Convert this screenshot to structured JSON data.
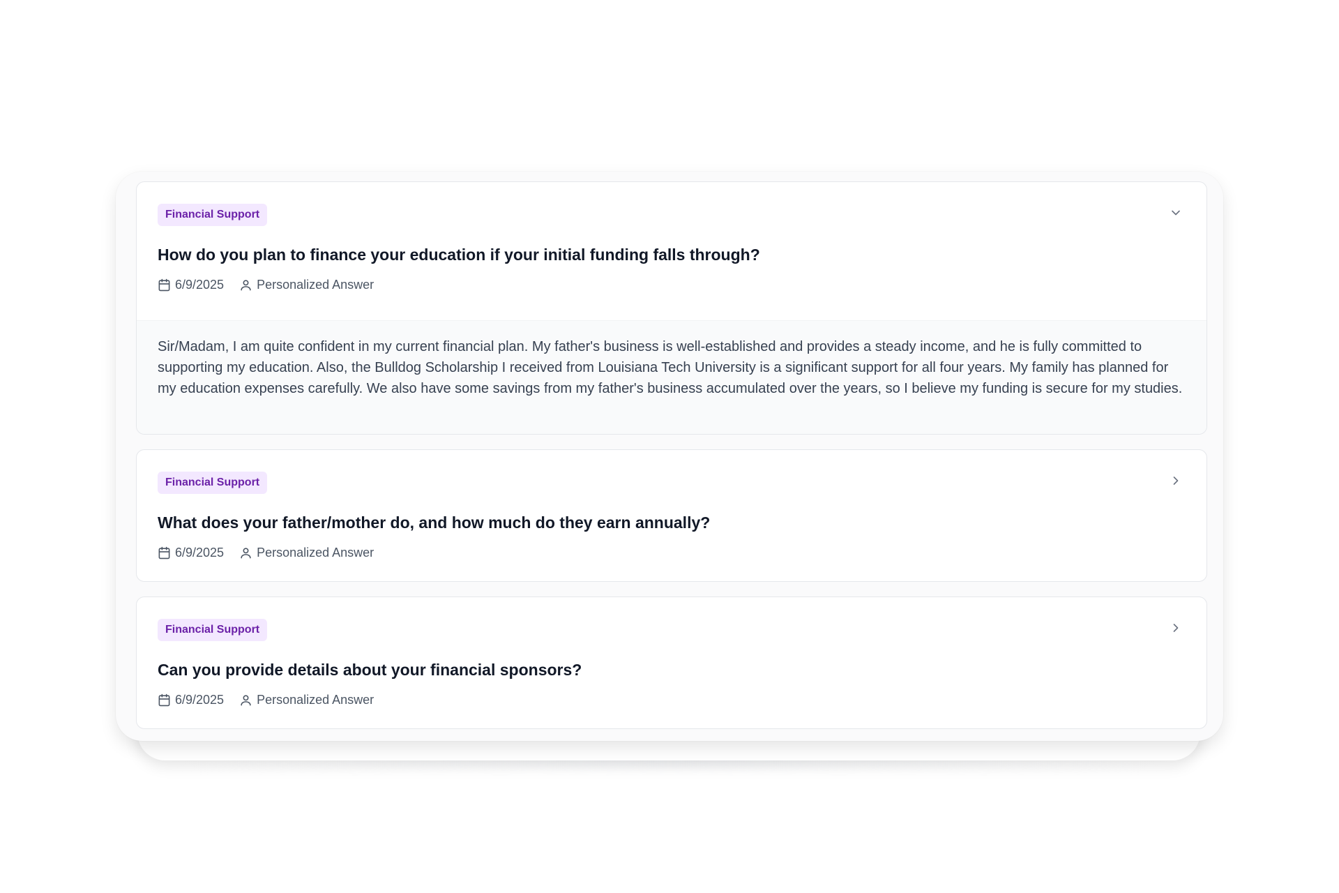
{
  "items": [
    {
      "category": "Financial Support",
      "question": "How do you plan to finance your education if your initial funding falls through?",
      "date": "6/9/2025",
      "answer_type": "Personalized Answer",
      "expanded": true,
      "answer": "Sir/Madam, I am quite confident in my current financial plan. My father's business is well-established and provides a steady income, and he is fully committed to supporting my education. Also, the Bulldog Scholarship I received from Louisiana Tech University is a significant support for all four years. My family has planned for my education expenses carefully. We also have some savings from my father's business accumulated over the years, so I believe my funding is secure for my studies."
    },
    {
      "category": "Financial Support",
      "question": "What does your father/mother do, and how much do they earn annually?",
      "date": "6/9/2025",
      "answer_type": "Personalized Answer",
      "expanded": false
    },
    {
      "category": "Financial Support",
      "question": "Can you provide details about your financial sponsors?",
      "date": "6/9/2025",
      "answer_type": "Personalized Answer",
      "expanded": false
    }
  ],
  "icons": {
    "expanded": "chevron-down-icon",
    "collapsed": "chevron-right-icon",
    "date": "calendar-icon",
    "answer_type": "user-icon"
  },
  "colors": {
    "badge_bg": "#f3e8ff",
    "badge_text": "#6b21a8",
    "answer_bg": "#f9fafb"
  }
}
